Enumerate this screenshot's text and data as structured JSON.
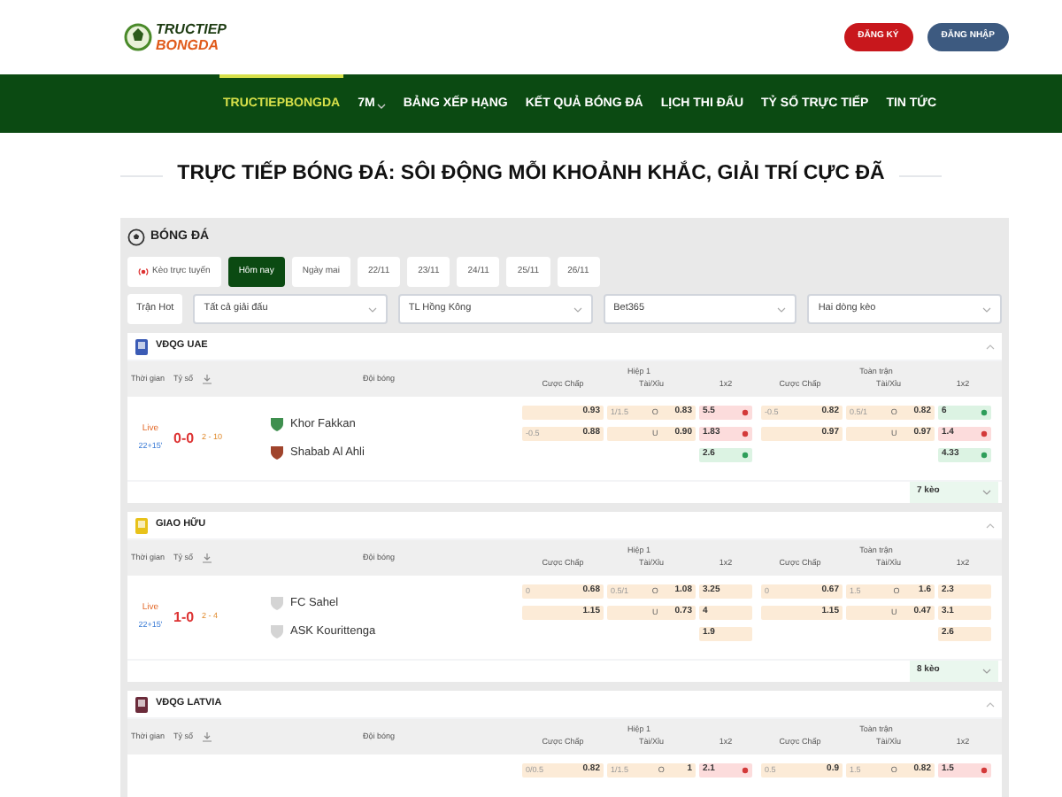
{
  "header": {
    "logo_lines": [
      "TRUCTIEP",
      "BONGDA"
    ],
    "buttons": [
      {
        "label": "ĐĂNG KÝ",
        "kind": "register"
      },
      {
        "label": "ĐĂNG NHẬP",
        "kind": "login"
      }
    ]
  },
  "nav": [
    {
      "label": "TRUCTIEPBONGDA",
      "selected": true
    },
    {
      "label": "7M",
      "selected": false,
      "dropdown": true
    },
    {
      "label": "BẢNG XẾP HẠNG",
      "selected": false
    },
    {
      "label": "KẾT QUẢ BÓNG ĐÁ",
      "selected": false
    },
    {
      "label": "LỊCH THI ĐẤU",
      "selected": false
    },
    {
      "label": "TỶ SỐ TRỰC TIẾP",
      "selected": false
    },
    {
      "label": "TIN TỨC",
      "selected": false
    }
  ],
  "page_title": "TRỰC TIẾP BÓNG ĐÁ: SÔI ĐỘNG MỖI KHOẢNH KHẮC, GIẢI TRÍ CỰC ĐÃ",
  "section_title": "BÓNG ĐÁ",
  "date_tabs": [
    {
      "label": "Kèo trực tuyến",
      "selected": false,
      "live": true
    },
    {
      "label": "Hôm nay",
      "selected": true
    },
    {
      "label": "Ngày mai",
      "selected": false
    },
    {
      "label": "22/11",
      "selected": false
    },
    {
      "label": "23/11",
      "selected": false
    },
    {
      "label": "24/11",
      "selected": false
    },
    {
      "label": "25/11",
      "selected": false
    },
    {
      "label": "26/11",
      "selected": false
    }
  ],
  "filters": {
    "hot_button": "Trận Hot",
    "selects": [
      "Tất cả giải đấu",
      "TL Hồng Kông",
      "Bet365",
      "Hai dòng kèo"
    ]
  },
  "leagues": [
    {
      "name": "VĐQG UAE",
      "color": "#3b5bb5",
      "expanded": true,
      "columns": {
        "time": "Thời gian",
        "score": "Tỷ số",
        "teams": "Đội bóng",
        "groups": [
          {
            "label": "Hiệp 1",
            "markets": [
              "Cược Chấp",
              "Tài/Xỉu",
              "1x2"
            ]
          },
          {
            "label": "Toàn trận",
            "markets": [
              "Cược Chấp",
              "Tài/Xỉu",
              "1x2"
            ]
          }
        ]
      },
      "matches": [
        {
          "status": "Live",
          "minute": "22+15'",
          "score": "0-0",
          "half_score": "2 - 10",
          "teams": [
            {
              "name": "Khor Fakkan",
              "color": "#3f8f4f"
            },
            {
              "name": "Shabab Al Ahli",
              "color": "#a0442c"
            }
          ],
          "odds": [
            [
              {
                "hdp": "0.93",
                "ou_line": "1/1.5",
                "ou_side": "O",
                "ou": "0.83",
                "x12": "5.5",
                "rising": false
              },
              {
                "hdp": "-0.5",
                "hdp_val": "0.82",
                "ou_line": "0.5/1",
                "ou_side": "O",
                "ou": "0.82",
                "x12": "6",
                "rising": true
              }
            ],
            [
              {
                "hdp_line": "-0.5",
                "hdp": "0.88",
                "ou_side": "U",
                "ou": "0.90",
                "x12": "1.83",
                "rising": false
              },
              {
                "hdp_val": "0.97",
                "ou_side": "U",
                "ou": "0.97",
                "x12": "1.4",
                "rising": false
              }
            ],
            [
              {
                "x12": "2.6",
                "rising": true
              },
              {
                "x12": "4.33",
                "rising": true
              }
            ]
          ],
          "more": "7 kèo"
        }
      ]
    },
    {
      "name": "GIAO HỮU",
      "color": "#e8c21a",
      "expanded": true,
      "columns": {
        "time": "Thời gian",
        "score": "Tỷ số",
        "teams": "Đội bóng",
        "groups": [
          {
            "label": "Hiệp 1",
            "markets": [
              "Cược Chấp",
              "Tài/Xỉu",
              "1x2"
            ]
          },
          {
            "label": "Toàn trận",
            "markets": [
              "Cược Chấp",
              "Tài/Xỉu",
              "1x2"
            ]
          }
        ]
      },
      "matches": [
        {
          "status": "Live",
          "minute": "22+15'",
          "score": "1-0",
          "half_score": "2 - 4",
          "teams": [
            {
              "name": "FC Sahel",
              "color": "#d4d4d4"
            },
            {
              "name": "ASK Kourittenga",
              "color": "#d4d4d4"
            }
          ],
          "odds": [
            [
              {
                "hdp_line": "0",
                "hdp": "0.68",
                "ou_line": "0.5/1",
                "ou_side": "O",
                "ou": "1.08",
                "x12": "3.25"
              },
              {
                "hdp": "0",
                "hdp_val": "0.67",
                "ou_line": "1.5",
                "ou_side": "O",
                "ou": "1.6",
                "x12": "2.3"
              }
            ],
            [
              {
                "hdp": "1.15",
                "ou_side": "U",
                "ou": "0.73",
                "x12": "4"
              },
              {
                "hdp_val": "1.15",
                "ou_side": "U",
                "ou": "0.47",
                "x12": "3.1"
              }
            ],
            [
              {
                "x12": "1.9"
              },
              {
                "x12": "2.6"
              }
            ]
          ],
          "more": "8 kèo"
        }
      ]
    },
    {
      "name": "VĐQG LATVIA",
      "color": "#6b2b3a",
      "expanded": true,
      "columns": {
        "time": "Thời gian",
        "score": "Tỷ số",
        "teams": "Đội bóng",
        "groups": [
          {
            "label": "Hiệp 1",
            "markets": [
              "Cược Chấp",
              "Tài/Xỉu",
              "1x2"
            ]
          },
          {
            "label": "Toàn trận",
            "markets": [
              "Cược Chấp",
              "Tài/Xỉu",
              "1x2"
            ]
          }
        ]
      },
      "matches": [
        {
          "odds": [
            [
              {
                "hdp_line": "0/0.5",
                "hdp": "0.82",
                "ou_line": "1/1.5",
                "ou_side": "O",
                "ou": "1",
                "x12": "2.1",
                "rising": false
              },
              {
                "hdp": "0.5",
                "hdp_val": "0.9",
                "ou_line": "1.5",
                "ou_side": "O",
                "ou": "0.82",
                "x12": "1.5",
                "rising": false
              }
            ]
          ]
        }
      ]
    }
  ]
}
